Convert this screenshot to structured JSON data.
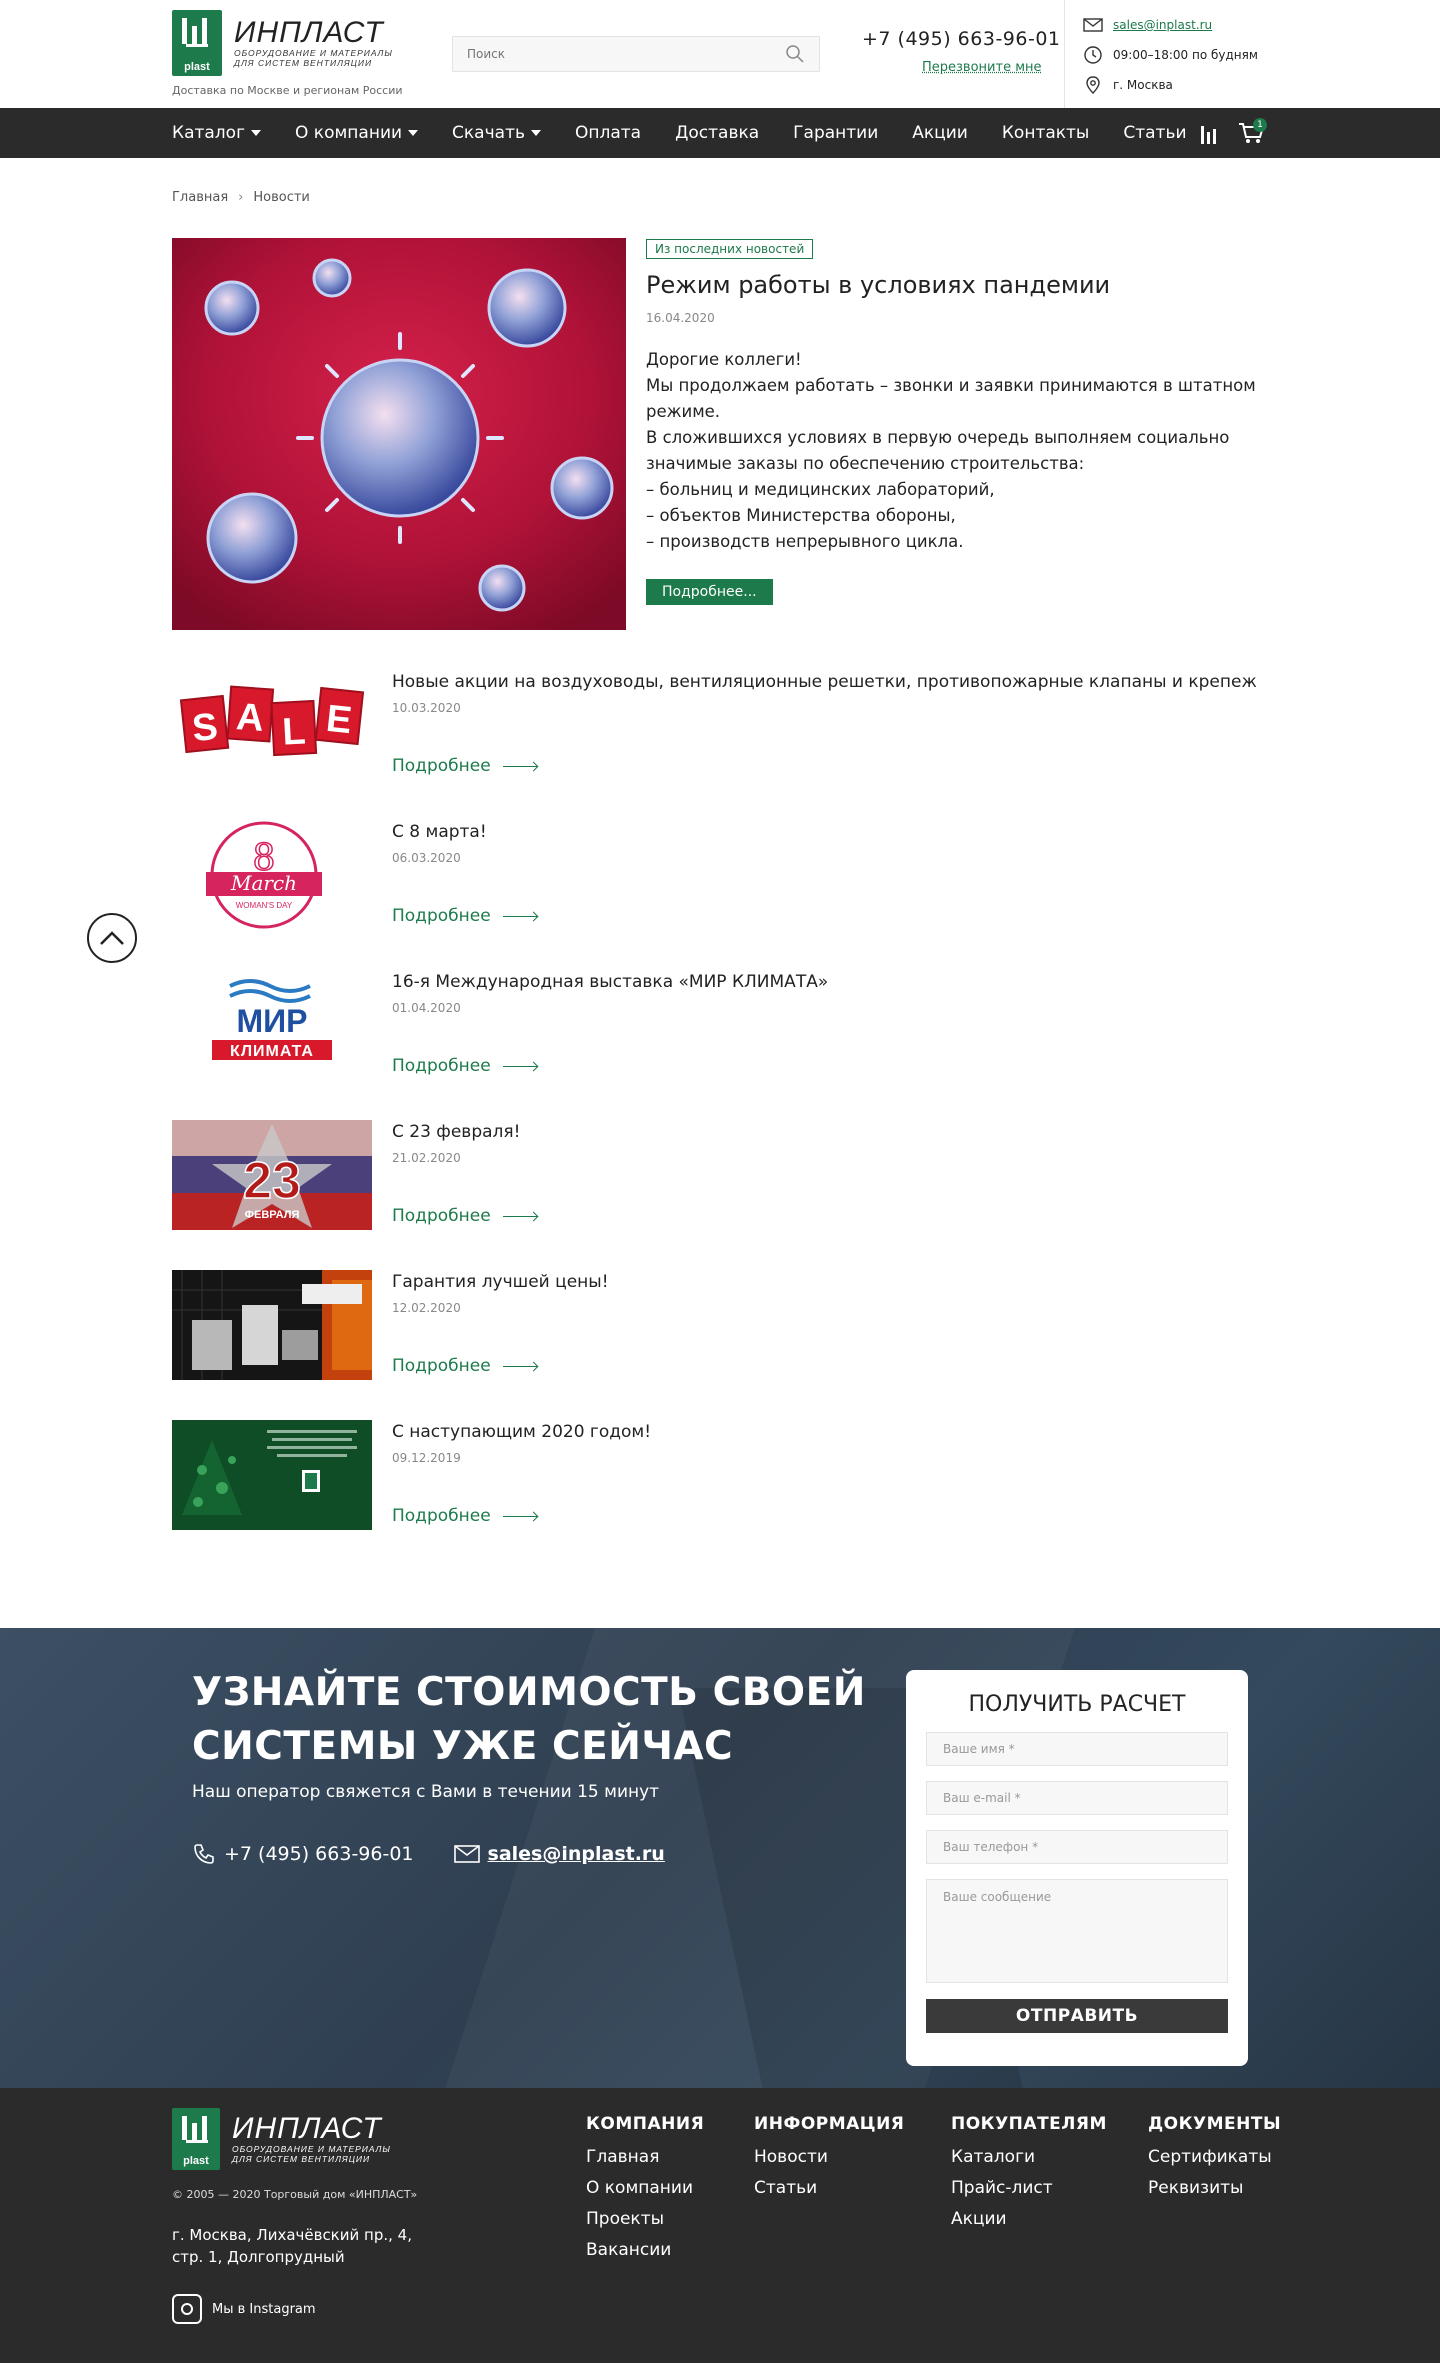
{
  "header": {
    "logo": {
      "name": "ИНПЛАСТ",
      "subline1": "ОБОРУДОВАНИЕ И МАТЕРИАЛЫ",
      "subline2": "ДЛЯ СИСТЕМ ВЕНТИЛЯЦИИ",
      "badge": "plast"
    },
    "delivery_note": "Доставка по Москве и регионам России",
    "search_placeholder": "Поиск",
    "phone": "+7 (495) 663-96-01",
    "callback": "Перезвоните мне",
    "email": "sales@inplast.ru",
    "hours": "09:00–18:00 по будням",
    "city": "г. Москва"
  },
  "nav": {
    "items": [
      {
        "label": "Каталог",
        "dropdown": true
      },
      {
        "label": "О компании",
        "dropdown": true
      },
      {
        "label": "Скачать",
        "dropdown": true
      },
      {
        "label": "Оплата",
        "dropdown": false
      },
      {
        "label": "Доставка",
        "dropdown": false
      },
      {
        "label": "Гарантии",
        "dropdown": false
      },
      {
        "label": "Акции",
        "dropdown": false
      },
      {
        "label": "Контакты",
        "dropdown": false
      },
      {
        "label": "Статьи",
        "dropdown": false
      }
    ],
    "cart_count": "1"
  },
  "breadcrumb": {
    "home": "Главная",
    "current": "Новости"
  },
  "featured": {
    "tag": "Из последних новостей",
    "title": "Режим работы в условиях пандемии",
    "date": "16.04.2020",
    "paragraphs": [
      "Дорогие коллеги!",
      "Мы продолжаем работать – звонки и заявки принимаются в штатном режиме.",
      "В сложившихся условиях в первую очередь выполняем социально значимые заказы по обеспечению строительства:",
      "– больниц и медицинских лабораторий,",
      "– объектов Министерства обороны,",
      "– производств непрерывного цикла."
    ],
    "button": "Подробнее..."
  },
  "more_label": "Подробнее",
  "news": [
    {
      "title": "Новые акции на воздуховоды, вентиляционные решетки, противопожарные клапаны и крепеж",
      "date": "10.03.2020",
      "thumb": "sale",
      "thumb_letters": [
        "S",
        "A",
        "L",
        "E"
      ]
    },
    {
      "title": "С 8 марта!",
      "date": "06.03.2020",
      "thumb": "march",
      "thumb_num": "8",
      "thumb_word": "March",
      "thumb_sub": "WOMAN'S DAY"
    },
    {
      "title": "16-я Международная выставка «МИР КЛИМАТА»",
      "date": "01.04.2020",
      "thumb": "climate",
      "thumb_word": "МИР",
      "thumb_word2": "КЛИМАТА"
    },
    {
      "title": "С 23 февраля!",
      "date": "21.02.2020",
      "thumb": "feb23",
      "thumb_num": "23",
      "thumb_word": "ФЕВРАЛЯ"
    },
    {
      "title": "Гарантия лучшей цены!",
      "date": "12.02.2020",
      "thumb": "price"
    },
    {
      "title": "С наступающим 2020 годом!",
      "date": "09.12.2019",
      "thumb": "newyear"
    }
  ],
  "cta": {
    "title_line1": "УЗНАЙТЕ СТОИМОСТЬ СВОЕЙ",
    "title_line2": "СИСТЕМЫ УЖЕ СЕЙЧАС",
    "subtitle": "Наш оператор свяжется с Вами в течении 15 минут",
    "phone": "+7 (495) 663-96-01",
    "email": "sales@inplast.ru"
  },
  "form": {
    "title": "ПОЛУЧИТЬ РАСЧЕТ",
    "name_placeholder": "Ваше имя  *",
    "email_placeholder": "Ваш e-mail  *",
    "phone_placeholder": "Ваш телефон  *",
    "message_placeholder": "Ваше сообщение",
    "submit": "ОТПРАВИТЬ"
  },
  "footer": {
    "copyright": "© 2005 — 2020 Торговый дом «ИНПЛАСТ»",
    "address_line1": "г. Москва, Лихачёвский пр., 4,",
    "address_line2": "стр. 1, Долгопрудный",
    "instagram": "Мы в Instagram",
    "columns": [
      {
        "title": "КОМПАНИЯ",
        "links": [
          "Главная",
          "О компании",
          "Проекты",
          "Вакансии"
        ]
      },
      {
        "title": "ИНФОРМАЦИЯ",
        "links": [
          "Новости",
          "Статьи"
        ]
      },
      {
        "title": "ПОКУПАТЕЛЯМ",
        "links": [
          "Каталоги",
          "Прайс-лист",
          "Акции"
        ]
      },
      {
        "title": "ДОКУМЕНТЫ",
        "links": [
          "Сертификаты",
          "Реквизиты"
        ]
      }
    ]
  },
  "colors": {
    "accent": "#1d7a4a",
    "nav_bg": "#2b2b2b",
    "footer_bg": "#2b2b2b"
  }
}
